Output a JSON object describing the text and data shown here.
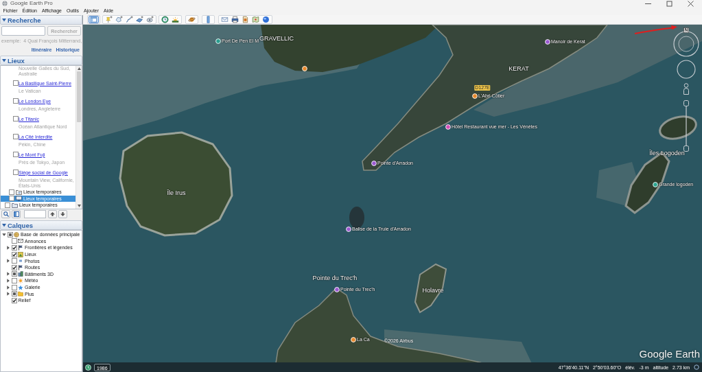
{
  "window": {
    "title": "Google Earth Pro"
  },
  "menu": [
    {
      "label": "Fichier"
    },
    {
      "label": "Édition"
    },
    {
      "label": "Affichage"
    },
    {
      "label": "Outils"
    },
    {
      "label": "Ajouter"
    },
    {
      "label": "Aide"
    }
  ],
  "search": {
    "title": "Recherche",
    "expanded": true,
    "button": {
      "label": "Rechercher",
      "disabled": true
    },
    "example": "exemple:  4 Quai François Mitterrand,",
    "links": [
      {
        "label": "Itinéraire"
      },
      {
        "label": "Historique"
      }
    ]
  },
  "places": {
    "title": "Lieux",
    "expanded": true,
    "top_fragment": "Nouvelle Galles du Sud, Australie",
    "tree": [
      {
        "children": [
          {
            "children": [
              {
                "kind": "place",
                "name": "La Basilique Saint-Pierre",
                "description": "Le Vatican",
                "checked": false,
                "selected": false
              },
              {
                "kind": "place",
                "name": "Le London Eye",
                "description": "Londres, Angleterre",
                "checked": false,
                "selected": false
              },
              {
                "kind": "place",
                "name": "Le Titanic",
                "description": "Océan Atlantique Nord",
                "checked": false,
                "selected": false
              },
              {
                "kind": "place",
                "name": "La Cité Interdite",
                "description": "Pékin, Chine",
                "checked": false,
                "selected": false
              },
              {
                "kind": "place",
                "name": "Le Mont Fuji",
                "description": "Près de Tokyo, Japon",
                "checked": false,
                "selected": false
              },
              {
                "kind": "place",
                "name": "Siège social de Google",
                "description": "Mountain View, Californie, États-Unis",
                "checked": false,
                "selected": false
              }
            ]
          },
          {
            "kind": "network",
            "name": "Lieux temporaires",
            "checked": false,
            "selected": false
          },
          {
            "kind": "tour",
            "name": "Lieux temporaires",
            "checked": false,
            "selected": true
          }
        ]
      },
      {
        "kind": "folder",
        "name": "Lieux temporaires",
        "checked": false,
        "selected": false
      }
    ]
  },
  "layers": {
    "title": "Calques",
    "expanded": true,
    "tree": [
      {
        "kind": "database",
        "name": "Base de données principale",
        "checked": false,
        "partial": true,
        "expandable": true,
        "expanded": true,
        "children": [
          {
            "kind": "envelope",
            "name": "Annonces",
            "checked": false,
            "partial": false,
            "expandable": false,
            "expanded": false
          },
          {
            "kind": "flag",
            "name": "Frontières et légendes",
            "checked": true,
            "partial": false,
            "expandable": true,
            "expanded": false
          },
          {
            "kind": "places",
            "name": "Lieux",
            "checked": true,
            "partial": false,
            "expandable": false,
            "expanded": false
          },
          {
            "kind": "photos",
            "name": "Photos",
            "checked": false,
            "partial": false,
            "expandable": true,
            "expanded": false
          },
          {
            "kind": "flag",
            "name": "Routes",
            "checked": true,
            "partial": false,
            "expandable": false,
            "expanded": false
          },
          {
            "kind": "buildings",
            "name": "Bâtiments 3D",
            "checked": false,
            "partial": true,
            "expandable": true,
            "expanded": false
          },
          {
            "kind": "weather",
            "name": "Météo",
            "checked": false,
            "partial": false,
            "expandable": true,
            "expanded": false
          },
          {
            "kind": "gallery",
            "name": "Galerie",
            "checked": false,
            "partial": false,
            "expandable": true,
            "expanded": false
          },
          {
            "kind": "more",
            "name": "Plus",
            "checked": false,
            "partial": true,
            "expandable": true,
            "expanded": false
          },
          {
            "kind": "plain",
            "name": "Relief",
            "checked": true,
            "partial": false,
            "expandable": false,
            "expanded": false
          }
        ]
      }
    ]
  },
  "toolbar": {
    "sidebar_toggle": {
      "selected": true
    }
  },
  "map": {
    "labels": [
      {
        "kind": "poi",
        "text": "Port De Pen El M",
        "color": "#2a9d8f"
      },
      {
        "kind": "place",
        "text": "GRAVELLIC"
      },
      {
        "kind": "poi",
        "text": "Manoir de Kerat",
        "color": "#9b59d0"
      },
      {
        "kind": "marker",
        "color": "#e8892c"
      },
      {
        "kind": "place",
        "text": "KERAT"
      },
      {
        "kind": "road",
        "text": "D127E"
      },
      {
        "kind": "poi",
        "text": "L'Abri Côtier",
        "color": "#e8892c"
      },
      {
        "kind": "poi",
        "text": "Hôtel Restaurant vue mer - Les Vénètes",
        "color": "#d44fb5"
      },
      {
        "kind": "place",
        "text": "Îles Logoden"
      },
      {
        "kind": "poi",
        "text": "Pointe d'Arradon",
        "color": "#9b59d0"
      },
      {
        "kind": "poi",
        "text": "Grande logoden",
        "color": "#2ba58f"
      },
      {
        "kind": "place",
        "text": "Île Irus"
      },
      {
        "kind": "poi",
        "text": "Balise de la Truie d'Arradon",
        "color": "#9b59d0"
      },
      {
        "kind": "place",
        "text": "Pointe du Trec'h"
      },
      {
        "kind": "poi",
        "text": "Pointe du Trec'h",
        "color": "#9b59d0"
      },
      {
        "kind": "place",
        "text": "Holavre"
      },
      {
        "kind": "poi",
        "text": "La Ca",
        "color": "#e8892c"
      }
    ],
    "copyright": "©2026 Airbus",
    "logo": "Google Earth"
  },
  "navigation": {
    "north_label": "N"
  },
  "status_bar": {
    "imagery_date": "1986",
    "latitude": "47°36'40.11\"N",
    "longitude": "2°50'03.60\"O",
    "elevation_label": "élév.",
    "elevation": "-3 m",
    "altitude_label": "altitude",
    "altitude": "2.73 km"
  }
}
